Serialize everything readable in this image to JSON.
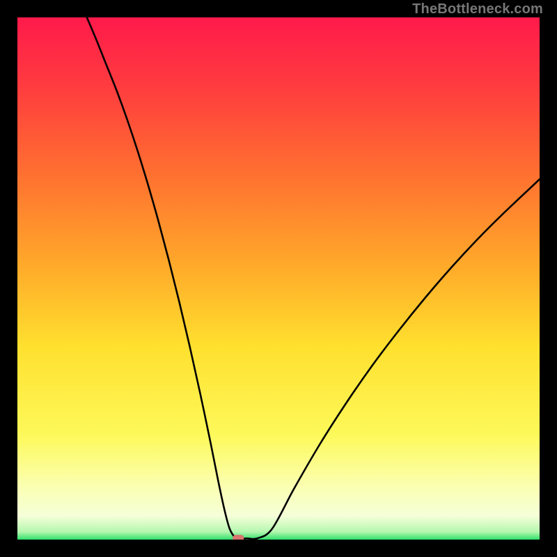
{
  "watermark": "TheBottleneck.com",
  "chart_data": {
    "type": "line",
    "title": "",
    "xlabel": "",
    "ylabel": "",
    "xlim": [
      0,
      100
    ],
    "ylim": [
      0,
      100
    ],
    "gradient_stops": [
      {
        "offset": 0.0,
        "color": "#ff1a4b"
      },
      {
        "offset": 0.13,
        "color": "#ff3b3f"
      },
      {
        "offset": 0.3,
        "color": "#ff7030"
      },
      {
        "offset": 0.48,
        "color": "#ffab2a"
      },
      {
        "offset": 0.63,
        "color": "#ffe02e"
      },
      {
        "offset": 0.8,
        "color": "#fdf95a"
      },
      {
        "offset": 0.9,
        "color": "#fbffb3"
      },
      {
        "offset": 0.955,
        "color": "#f5ffd8"
      },
      {
        "offset": 0.985,
        "color": "#b5f7b0"
      },
      {
        "offset": 1.0,
        "color": "#2fe06a"
      }
    ],
    "series": [
      {
        "name": "bottleneck-curve",
        "x": [
          13.3,
          15,
          17,
          19,
          21,
          23,
          25,
          27,
          29,
          31,
          33,
          35,
          37,
          38.5,
          39.7,
          40.6,
          41.5,
          42.3,
          44.0,
          46,
          48.8,
          53,
          58,
          63,
          68,
          73,
          78,
          83,
          88,
          93,
          100
        ],
        "values": [
          100.0,
          96,
          91,
          86,
          80.5,
          74.5,
          68,
          61,
          53.5,
          45.5,
          37,
          28,
          18.5,
          11,
          5.5,
          2.2,
          0.6,
          0.2,
          0.22,
          0.25,
          2.1,
          9.8,
          18.4,
          26.2,
          33.4,
          40.0,
          46.2,
          52.0,
          57.4,
          62.4,
          69.0
        ]
      }
    ],
    "marker": {
      "x": 42.3,
      "y": 0.3,
      "color": "#d9746e"
    }
  }
}
